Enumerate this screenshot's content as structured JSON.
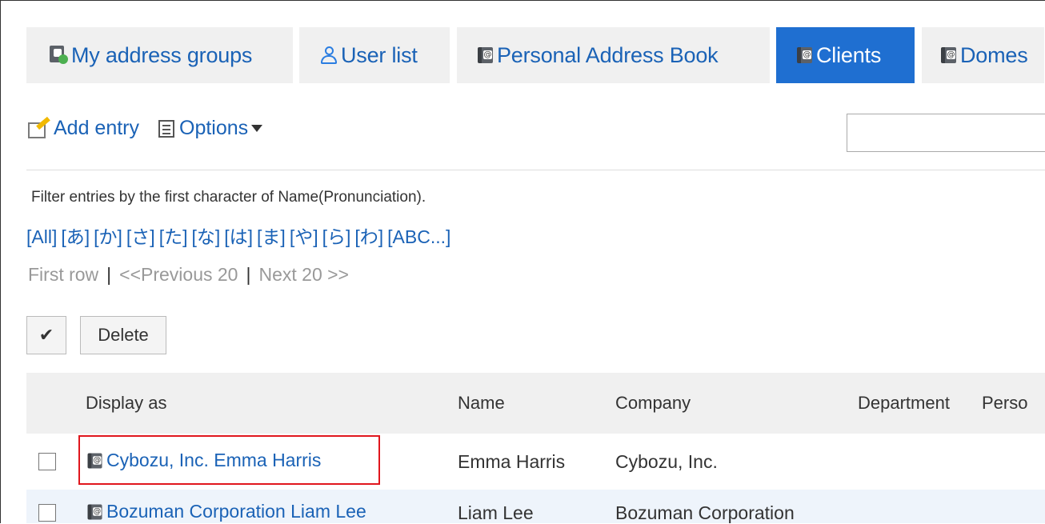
{
  "tabs": [
    {
      "label": "My address groups",
      "icon": "address-group-icon",
      "active": false
    },
    {
      "label": "User list",
      "icon": "user-icon",
      "active": false
    },
    {
      "label": "Personal Address Book",
      "icon": "address-book-icon",
      "active": false
    },
    {
      "label": "Clients",
      "icon": "address-book-icon",
      "active": true
    },
    {
      "label": "Domes",
      "icon": "address-book-icon",
      "active": false
    }
  ],
  "toolbar": {
    "add_entry": "Add entry",
    "options": "Options"
  },
  "search": {
    "value": ""
  },
  "filter": {
    "description": "Filter entries by the first character of Name(Pronunciation).",
    "letters": [
      "[All]",
      "[あ]",
      "[か]",
      "[さ]",
      "[た]",
      "[な]",
      "[は]",
      "[ま]",
      "[や]",
      "[ら]",
      "[わ]",
      "[ABC...]"
    ]
  },
  "paging": {
    "first": "First row",
    "separator": "|",
    "prev": "<<Previous 20",
    "next": "Next 20 >>"
  },
  "actions": {
    "check_all": "✔",
    "delete": "Delete"
  },
  "table": {
    "headers": [
      "Display as",
      "Name",
      "Company",
      "Department",
      "Perso"
    ],
    "rows": [
      {
        "display_as": "Cybozu, Inc. Emma Harris",
        "name": "Emma Harris",
        "company": "Cybozu, Inc."
      },
      {
        "display_as": "Bozuman Corporation Liam Lee",
        "name": "Liam Lee",
        "company": "Bozuman Corporation"
      }
    ]
  },
  "colors": {
    "accent": "#1f6fd1",
    "link": "#1a62b6",
    "highlight": "#e0161d"
  }
}
